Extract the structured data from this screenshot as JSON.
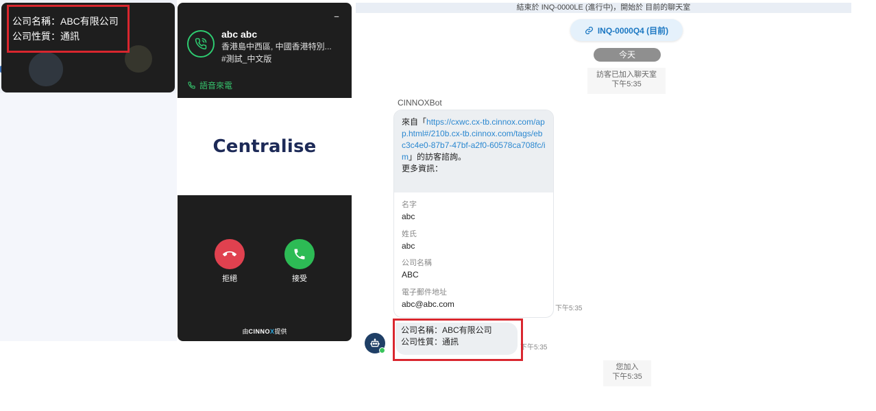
{
  "popup": {
    "line1": "公司名稱：ABC有限公司",
    "line2": "公司性質：通訊"
  },
  "call": {
    "minimize_label": "–",
    "caller_name": "abc abc",
    "caller_location": "香港島中西區, 中國香港特別...",
    "caller_tag": "#測試_中文版",
    "call_type": "語音來電",
    "brand": "Centralise",
    "decline_label": "拒絕",
    "accept_label": "接受",
    "powered_prefix": "由",
    "powered_brand": "CINNO",
    "powered_x": "X",
    "powered_suffix": "提供"
  },
  "chat": {
    "banner": "結束於 INQ-0000LE (進行中)，開始於 目前的聊天室",
    "inquiry_pill": "INQ-0000Q4 (目前)",
    "today": "今天",
    "visitor_joined": "訪客已加入聊天室",
    "visitor_joined_time": "下午5:35",
    "bot_name": "CINNOXBot",
    "bot_intro_prefix": "來自「",
    "bot_intro_link": "https://cxwc.cx-tb.cinnox.com/app.html#/210b.cx-tb.cinnox.com/tags/ebc3c4e0-87b7-47bf-a2f0-60578ca708fc/im",
    "bot_intro_suffix": "」的訪客諮詢。",
    "bot_more_info": "更多資訊：",
    "fields": [
      {
        "label": "名字",
        "value": "abc"
      },
      {
        "label": "姓氏",
        "value": "abc"
      },
      {
        "label": "公司名稱",
        "value": "ABC"
      },
      {
        "label": "電子郵件地址",
        "value": "abc@abc.com"
      }
    ],
    "bot_card_time": "下午5:35",
    "message_line1": "公司名稱：ABC有限公司",
    "message_line2": "公司性質：通訊",
    "message_time": "下午5:35",
    "you_joined": "您加入",
    "you_joined_time": "下午5:35"
  },
  "colors": {
    "highlight_red": "#d9262e",
    "accept_green": "#2dbb55",
    "decline_red": "#e0414f",
    "link_blue": "#2a87d0",
    "call_type_green": "#35c06b"
  }
}
